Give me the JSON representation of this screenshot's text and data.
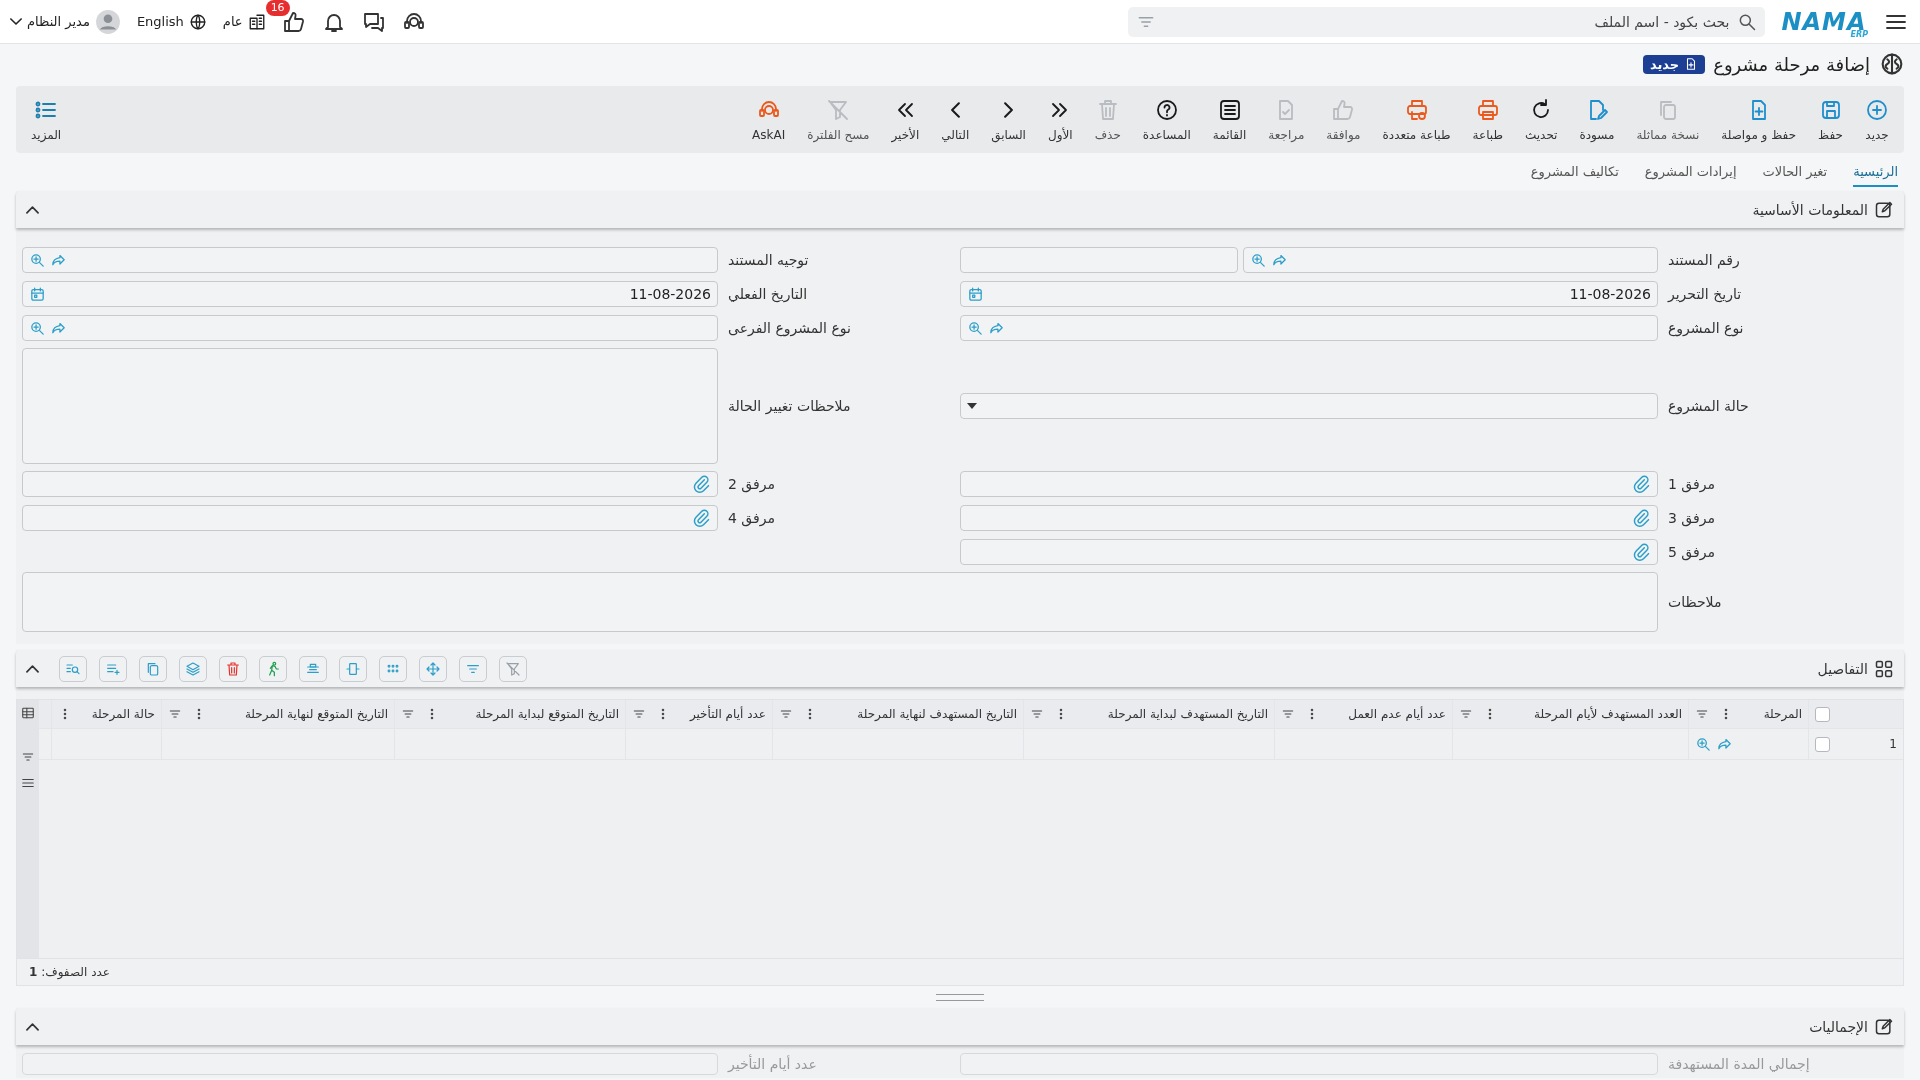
{
  "top_bar": {
    "logo": "NAMA",
    "logo_sub": "ERP",
    "search": {
      "placeholder": "بحث بكود - اسم الملف"
    },
    "user": "مدير النظام",
    "language": "English",
    "branch": "عام",
    "notification_count": "16"
  },
  "page": {
    "title": "إضافة مرحلة مشروع",
    "badge": "جديد"
  },
  "toolbar": {
    "items": [
      {
        "label": "جديد",
        "disabled": false
      },
      {
        "label": "حفظ",
        "disabled": false
      },
      {
        "label": "حفظ و مواصلة",
        "disabled": false
      },
      {
        "label": "نسخة مماثلة",
        "disabled": true
      },
      {
        "label": "مسودة",
        "disabled": false
      },
      {
        "label": "تحديث",
        "disabled": false
      },
      {
        "label": "طباعة",
        "disabled": false
      },
      {
        "label": "طباعة متعددة",
        "disabled": false
      },
      {
        "label": "موافقة",
        "disabled": true
      },
      {
        "label": "مراجعة",
        "disabled": true
      },
      {
        "label": "القائمة",
        "disabled": false
      },
      {
        "label": "المساعدة",
        "disabled": false
      },
      {
        "label": "حذف",
        "disabled": true
      },
      {
        "label": "الأول",
        "disabled": false
      },
      {
        "label": "السابق",
        "disabled": false
      },
      {
        "label": "التالي",
        "disabled": false
      },
      {
        "label": "الأخير",
        "disabled": false
      },
      {
        "label": "مسح الفلترة",
        "disabled": true
      },
      {
        "label": "AskAI",
        "disabled": false
      }
    ],
    "more": "المزيد"
  },
  "tabs": [
    {
      "label": "الرئيسية",
      "selected": true
    },
    {
      "label": "تغير الحالات",
      "selected": false
    },
    {
      "label": "إيرادات المشروع",
      "selected": false
    },
    {
      "label": "تكاليف المشروع",
      "selected": false
    }
  ],
  "main_section": {
    "title": "المعلومات الأساسية",
    "expanded": true,
    "rows": [
      {
        "fields": [
          {
            "label": "رقم المستند",
            "kind": "lookup_split"
          },
          {
            "label": "توجيه المستند",
            "kind": "lookup"
          }
        ]
      },
      {
        "fields": [
          {
            "label": "تاريخ التحرير",
            "kind": "date",
            "value": "11-08-2026"
          },
          {
            "label": "التاريخ الفعلي",
            "kind": "date",
            "value": "11-08-2026"
          }
        ]
      },
      {
        "fields": [
          {
            "label": "نوع المشروع",
            "kind": "lookup"
          },
          {
            "label": "نوع المشروع الفرعى",
            "kind": "lookup"
          }
        ]
      },
      {
        "fields": [
          {
            "label": "حالة المشروع",
            "kind": "select"
          },
          {
            "label": "ملاحظات تغيير الحالة",
            "kind": "textarea"
          }
        ]
      },
      {
        "fields": [
          {
            "label": "مرفق 1",
            "kind": "attachment"
          },
          {
            "label": "مرفق 2",
            "kind": "attachment"
          }
        ]
      },
      {
        "fields": [
          {
            "label": "مرفق 3",
            "kind": "attachment"
          },
          {
            "label": "مرفق 4",
            "kind": "attachment"
          }
        ]
      },
      {
        "fields": [
          {
            "label": "مرفق 5",
            "kind": "attachment"
          }
        ]
      },
      {
        "fields": [
          {
            "label": "ملاحظات",
            "kind": "notes"
          }
        ]
      }
    ]
  },
  "details": {
    "title": "التفاصيل",
    "expanded": true,
    "all_checked": false,
    "columns": [
      "المرحلة",
      "العدد المستهدف لأيام المرحلة",
      "عدد أيام عدم العمل",
      "التاريخ المستهدف لبداية المرحلة",
      "التاريخ المستهدف لنهاية المرحلة",
      "عدد أيام التأخير",
      "التاريخ المتوقع لبداية المرحلة",
      "التاريخ المتوقع لنهاية المرحلة",
      "حالة المرحلة"
    ],
    "rows": [
      {
        "number": "1",
        "checked": false
      }
    ],
    "row_count": "عدد الصفوف: **1**"
  },
  "totals": {
    "title": "الإجماليات",
    "expanded": true,
    "fields": [
      {
        "label": "إجمالي المدة المستهدفة"
      },
      {
        "label": "عدد أيام التأخير"
      }
    ]
  }
}
